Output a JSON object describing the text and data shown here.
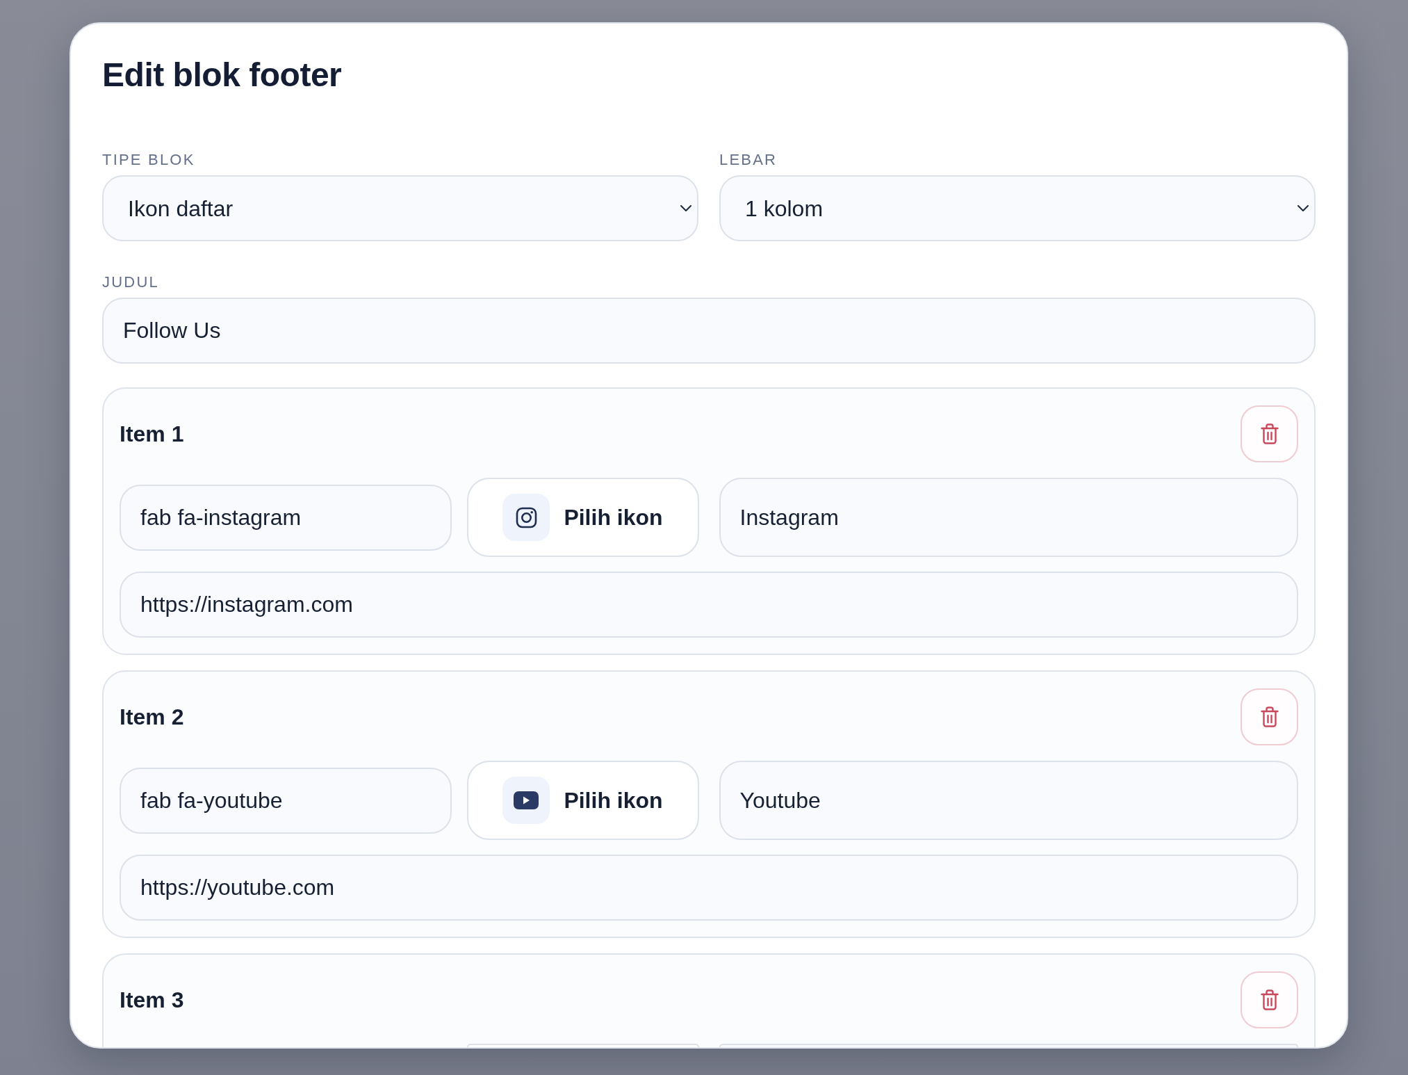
{
  "dialog": {
    "title": "Edit blok footer"
  },
  "fields": [
    {
      "kind": "select",
      "label": "TIPE BLOK",
      "value": "Ikon daftar"
    },
    {
      "kind": "select",
      "label": "LEBAR",
      "value": "1 kolom"
    },
    {
      "kind": "text",
      "label": "JUDUL",
      "value": "Follow Us"
    }
  ],
  "items": [
    {
      "title": "Item 1",
      "kind": "camera",
      "icon_class": "fab fa-instagram",
      "picker_label": "Pilih ikon",
      "label": "Instagram",
      "url": "https://instagram.com"
    },
    {
      "title": "Item 2",
      "kind": "play",
      "icon_class": "fab fa-youtube",
      "picker_label": "Pilih ikon",
      "label": "Youtube",
      "url": "https://youtube.com"
    },
    {
      "title": "Item 3"
    }
  ]
}
